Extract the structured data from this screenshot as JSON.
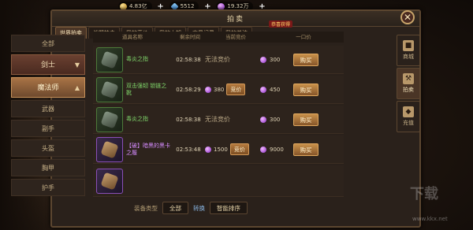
{
  "currency": {
    "gold": "4.83亿",
    "diamond": "5512",
    "jewel": "19.32万",
    "add_symbol": "+"
  },
  "panel": {
    "title": "拍卖",
    "badge": "恭喜获得"
  },
  "tabs": [
    "世界拍卖",
    "战盟拍卖",
    "我的竞价",
    "我的上架",
    "交易记录",
    "我的关注"
  ],
  "categories": [
    "全部",
    "剑士",
    "魔法师",
    "武器",
    "副手",
    "头盔",
    "胸甲",
    "护手"
  ],
  "table": {
    "headers": [
      "道具名称",
      "剩余时间",
      "当前竞价",
      "一口价"
    ],
    "buy_label": "购买",
    "bid_label": "竞价",
    "rows": [
      {
        "name": "毒炎之指",
        "time": "02:58:38",
        "bid_text": "无法竞价",
        "price": "300"
      },
      {
        "name": "双击强韧 锁链之靴",
        "time": "02:58:29",
        "bid_value": "380",
        "price": "450"
      },
      {
        "name": "毒炎之指",
        "time": "02:58:38",
        "bid_text": "无法竞价",
        "price": "300"
      },
      {
        "name": "【破】暗黑的黑卡之履",
        "time": "02:53:48",
        "bid_value": "1500",
        "price": "9000"
      }
    ]
  },
  "filters": {
    "equip_type_label": "装备类型",
    "equip_type_value": "全部",
    "swap_label": "转换",
    "sort_value": "智能排序"
  },
  "side_tabs": [
    "商城",
    "拍卖",
    "充值"
  ],
  "watermark": {
    "url": "www.kkx.net"
  },
  "colors": {
    "accent": "#c8904a",
    "green_item": "#7fd66a",
    "purple_item": "#d68cff"
  }
}
